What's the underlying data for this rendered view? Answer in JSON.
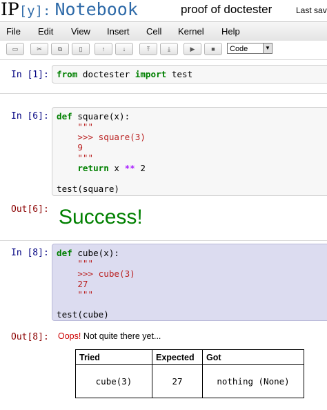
{
  "header": {
    "logo_ip": "IP",
    "logo_y": "[y]:",
    "logo_notebook": "Notebook",
    "notebook_name": "proof of doctester",
    "save_status": "Last save"
  },
  "menubar": {
    "items": [
      "File",
      "Edit",
      "View",
      "Insert",
      "Cell",
      "Kernel",
      "Help"
    ]
  },
  "toolbar": {
    "buttons": [
      {
        "icon": "save-icon",
        "glyph": "▭"
      },
      {
        "icon": "cut-icon",
        "glyph": "✂"
      },
      {
        "icon": "copy-icon",
        "glyph": "⧉"
      },
      {
        "icon": "paste-icon",
        "glyph": "▯"
      },
      {
        "icon": "move-up-icon",
        "glyph": "↑"
      },
      {
        "icon": "move-down-icon",
        "glyph": "↓"
      },
      {
        "icon": "insert-above-icon",
        "glyph": "⤒"
      },
      {
        "icon": "insert-below-icon",
        "glyph": "⤓"
      },
      {
        "icon": "run-icon",
        "glyph": "▶"
      },
      {
        "icon": "stop-icon",
        "glyph": "■"
      }
    ],
    "cell_type": "Code"
  },
  "cells": {
    "c1": {
      "prompt": "In [1]:",
      "code": {
        "kw1": "from",
        "mod": " doctester ",
        "kw2": "import",
        "name": " test"
      }
    },
    "c2": {
      "prompt": "In [6]:",
      "l1": {
        "kw": "def",
        "rest": " square(x):"
      },
      "l2": "    \"\"\"",
      "l3": "    >>> square(3)",
      "l4": "    9",
      "l5": "    \"\"\"",
      "l6": {
        "indent": "    ",
        "kw": "return",
        "a": " x ",
        "op": "**",
        "b": " 2"
      },
      "l7": "test(square)",
      "out_prompt": "Out[6]:",
      "output": "Success!"
    },
    "c3": {
      "prompt": "In [8]:",
      "l1": {
        "kw": "def",
        "rest": " cube(x):"
      },
      "l2": "    \"\"\"",
      "l3": "    >>> cube(3)",
      "l4": "    27",
      "l5": "    \"\"\"",
      "l6": "test(cube)",
      "out_prompt": "Out[8]:",
      "oops": "Oops!",
      "oops_rest": " Not quite there yet...",
      "table": {
        "headers": [
          "Tried",
          "Expected",
          "Got"
        ],
        "row": [
          "cube(3)",
          "27",
          "nothing (None)"
        ]
      }
    }
  },
  "colors": {
    "accent_blue": "#2e6aa8",
    "selected_cell_bg": "#dcdcf0",
    "success_green": "#008000",
    "oops_red": "#cc0000"
  }
}
